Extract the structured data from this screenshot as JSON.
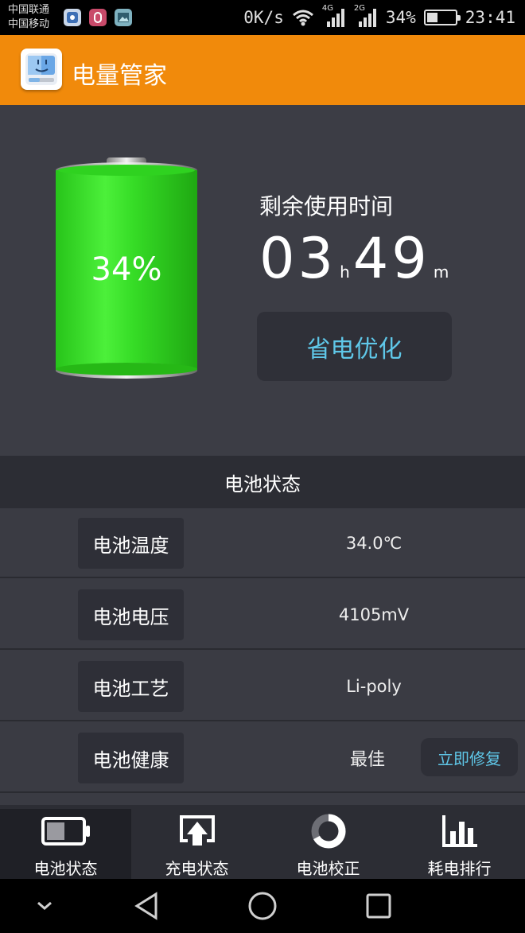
{
  "status_bar": {
    "carrier_1": "中国联通",
    "carrier_2": "中国移动",
    "speed": "0K/s",
    "net_4g": "4G",
    "net_2g": "2G",
    "battery_percent": "34%",
    "time": "23:41",
    "icons": [
      "app-notify-icon",
      "app-record-icon",
      "gallery-icon",
      "wifi-icon",
      "signal-4g-icon",
      "signal-2g-icon",
      "battery-charging-icon"
    ]
  },
  "app_bar": {
    "title": "电量管家",
    "logo": "finder-logo-icon"
  },
  "hero": {
    "battery_level": 0.34,
    "battery_text": "34%",
    "remaining_label": "剩余使用时间",
    "hours": "03",
    "hours_unit": "h",
    "minutes": "49",
    "minutes_unit": "m",
    "optimize_button": "省电优化"
  },
  "battery_status": {
    "header": "电池状态",
    "rows": [
      {
        "label": "电池温度",
        "value": "34.0℃"
      },
      {
        "label": "电池电压",
        "value": "4105mV"
      },
      {
        "label": "电池工艺",
        "value": "Li-poly"
      },
      {
        "label": "电池健康",
        "value": "最佳"
      }
    ],
    "repair_button": "立即修复"
  },
  "tabs": [
    {
      "label": "电池状态",
      "icon": "battery-icon",
      "active": true
    },
    {
      "label": "充电状态",
      "icon": "charge-up-icon",
      "active": false
    },
    {
      "label": "电池校正",
      "icon": "calibrate-ring-icon",
      "active": false
    },
    {
      "label": "耗电排行",
      "icon": "bar-chart-icon",
      "active": false
    }
  ],
  "colors": {
    "accent_orange": "#f18a0b",
    "battery_green": "#3ee52a",
    "link_blue": "#5fc7e8",
    "panel_bg": "#3c3d45"
  }
}
